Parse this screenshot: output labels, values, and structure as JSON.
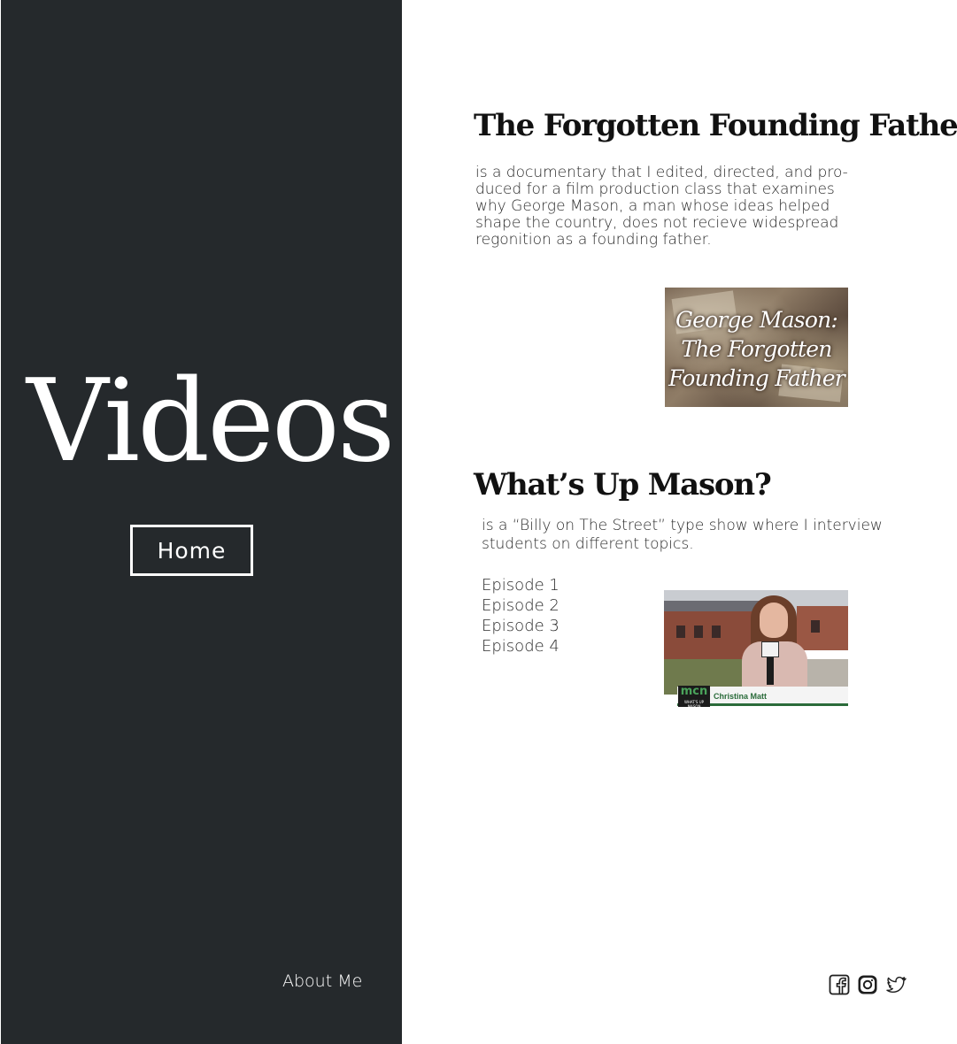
{
  "sidebar": {
    "title": "Videos",
    "home_label": "Home",
    "about_label": "About Me"
  },
  "documentary": {
    "heading": "The Forgotten Founding Father",
    "description": "is a documentary that I edited, directed, and pro-duced for a film production class that examines why George Mason, a man whose ideas helped shape the country, does not recieve widespread regonition as a founding father.",
    "thumbnail_text": [
      "George Mason:",
      "The Forgotten",
      "Founding Father"
    ]
  },
  "whats_up_mason": {
    "heading": "What’s Up Mason?",
    "description": "is a “Billy on The Street” type show where I interview students on different topics.",
    "episodes": [
      "Episode 1",
      "Episode 2",
      "Episode 3",
      "Episode 4"
    ],
    "thumbnail": {
      "logo_text": "mcn",
      "logo_subtext": "WHAT'S UP MASON",
      "name_label": "Christina Matt"
    }
  },
  "social": {
    "icons": [
      "facebook-icon",
      "instagram-icon",
      "twitter-icon"
    ]
  },
  "colors": {
    "sidebar_bg": "#25292c",
    "page_bg": "#ffffff",
    "accent_green": "#2a6b3a"
  }
}
